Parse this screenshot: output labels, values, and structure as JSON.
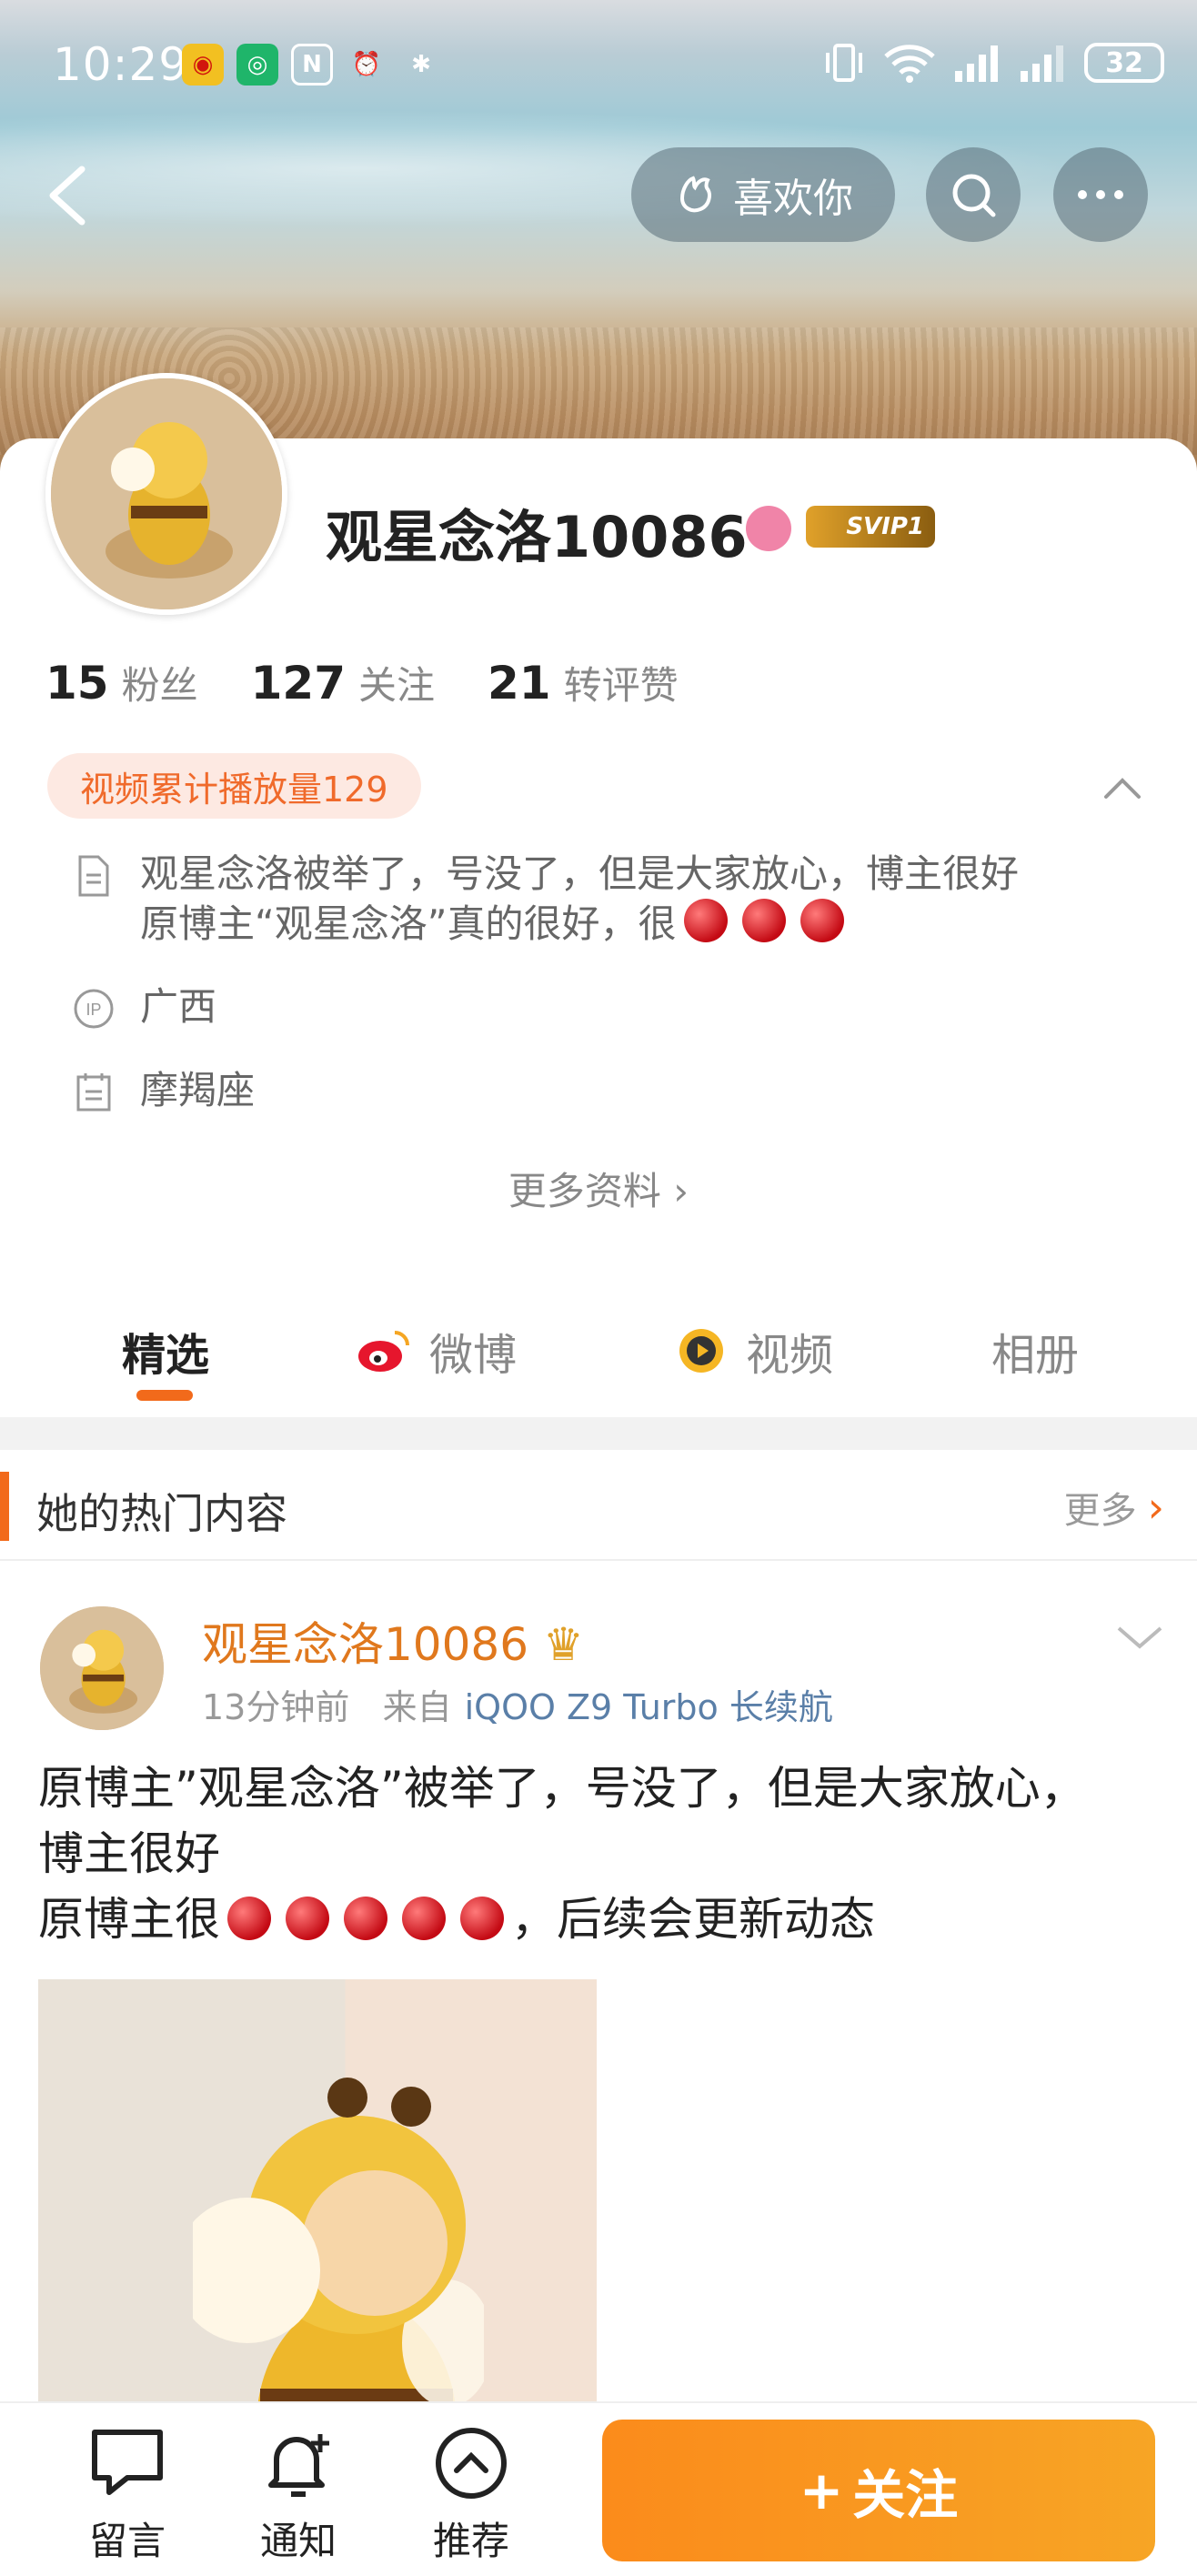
{
  "status_bar": {
    "time": "10:29",
    "battery": "32"
  },
  "header": {
    "like_label": "喜欢你"
  },
  "profile": {
    "name": "观星念洛10086",
    "vip_label": "SVIP1",
    "stats": [
      {
        "count": "15",
        "label": "粉丝"
      },
      {
        "count": "127",
        "label": "关注"
      },
      {
        "count": "21",
        "label": "转评赞"
      }
    ],
    "video_plays": "视频累计播放量129",
    "bio_line1": "观星念洛被举了，号没了，但是大家放心，博主很好",
    "bio_line2": "原博主“观星念洛”真的很好，很",
    "location": "广西",
    "zodiac": "摩羯座",
    "more_info": "更多资料"
  },
  "tabs": [
    {
      "label": "精选"
    },
    {
      "label": "微博"
    },
    {
      "label": "视频"
    },
    {
      "label": "相册"
    }
  ],
  "hot": {
    "title": "她的热门内容",
    "more": "更多"
  },
  "post": {
    "author": "观星念洛10086",
    "time": "13分钟前",
    "source_prefix": "来自",
    "device": "iQOO Z9 Turbo 长续航",
    "line1": "原博主”观星念洛”被举了，号没了，但是大家放心，",
    "line2": "博主很好",
    "line3_start": "原博主很",
    "line3_end": "，后续会更新动态"
  },
  "bottom_nav": [
    {
      "label": "留言"
    },
    {
      "label": "通知"
    },
    {
      "label": "推荐"
    }
  ],
  "follow_label": "关注",
  "colors": {
    "accent": "#f26a1b",
    "follow": "#fb8b1b"
  }
}
